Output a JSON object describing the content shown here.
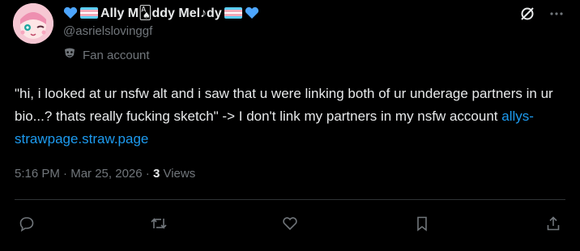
{
  "user": {
    "display_name_emoji_left": "💙🏳️‍⚧️",
    "display_name": "Ally M🂡ddy Mel♪dy",
    "display_name_emoji_right": "🏳️‍⚧️💙",
    "handle": "@asrielslovinggf",
    "badge_label": "Fan account",
    "badge_icon": "mask-icon",
    "avatar_icon": "avatar-icon"
  },
  "post": {
    "text_main": "\"hi, i looked at ur nsfw alt and i saw that u were linking both of ur underage partners in ur bio...? thats really fucking sketch\" -> I don't link my partners in my nsfw account ",
    "link_text": "allys-strawpage.straw.page",
    "time": "5:16 PM",
    "separator": " · ",
    "date": "Mar 25, 2026",
    "views_count": "3",
    "views_label": " Views"
  },
  "top_actions": {
    "grok_icon": "grok-icon",
    "more_icon": "more-icon"
  },
  "actions": [
    "reply-icon",
    "retweet-icon",
    "like-icon",
    "bookmark-icon",
    "share-icon"
  ],
  "colors": {
    "background": "#000000",
    "text": "#e7e9ea",
    "muted": "#71767b",
    "link": "#1d9bf0",
    "divider": "#2f3336",
    "heart": "#4da6ff",
    "flag_blue": "#5bcefa",
    "flag_pink": "#f5a9b8",
    "flag_white": "#ffffff"
  }
}
